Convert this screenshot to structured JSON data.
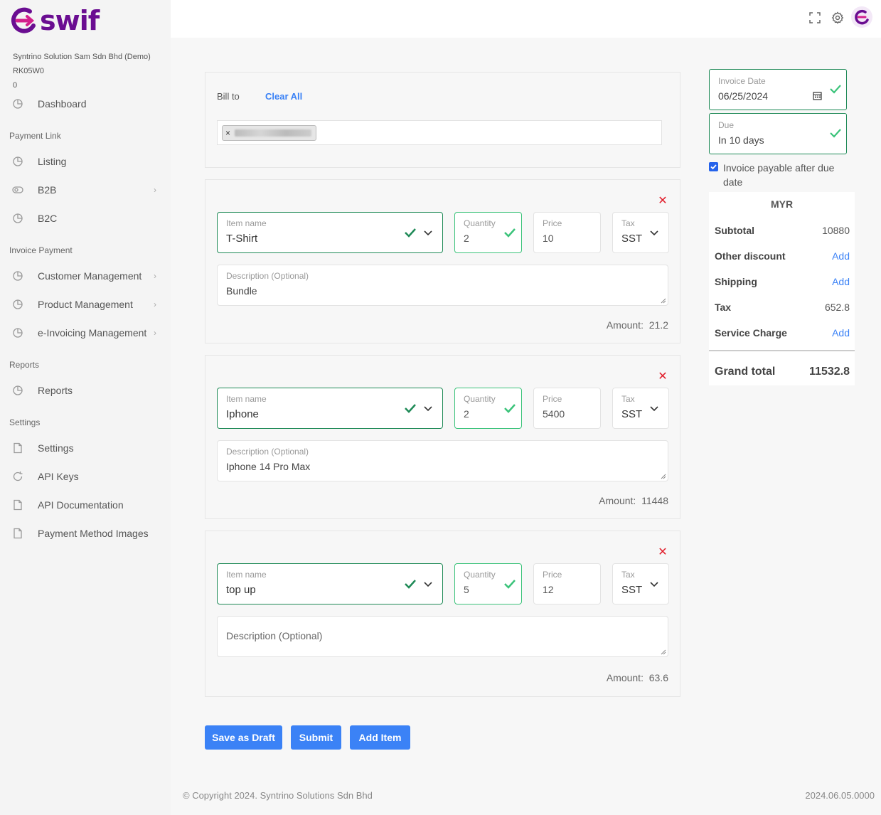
{
  "brand": {
    "name": "swif",
    "color": "#6a0d91",
    "accent": "#d31f8c"
  },
  "company": {
    "name": "Syntrino Solution Sam Sdn Bhd (Demo)",
    "code": "RK05W0",
    "balance": "0"
  },
  "sidebar": {
    "dashboard": "Dashboard",
    "sections": {
      "payment_link": "Payment Link",
      "invoice_payment": "Invoice Payment",
      "reports": "Reports",
      "settings": "Settings"
    },
    "items": {
      "listing": "Listing",
      "b2b": "B2B",
      "b2c": "B2C",
      "customer_management": "Customer Management",
      "product_management": "Product Management",
      "einvoicing_management": "e-Invoicing Management",
      "reports": "Reports",
      "settings": "Settings",
      "api_keys": "API Keys",
      "api_documentation": "API Documentation",
      "payment_method_images": "Payment Method Images"
    }
  },
  "bill_to": {
    "label": "Bill to",
    "clear_all": "Clear All",
    "tag_remove": "×"
  },
  "labels": {
    "item_name": "Item name",
    "quantity": "Quantity",
    "price": "Price",
    "tax": "Tax",
    "description": "Description (Optional)",
    "amount": "Amount:"
  },
  "items": [
    {
      "name": "T-Shirt",
      "quantity": "2",
      "price": "10",
      "tax": "SST",
      "description": "Bundle",
      "amount": "21.2"
    },
    {
      "name": "Iphone",
      "quantity": "2",
      "price": "5400",
      "tax": "SST",
      "description": "Iphone 14 Pro Max",
      "amount": "11448"
    },
    {
      "name": "top up",
      "quantity": "5",
      "price": "12",
      "tax": "SST",
      "description": "",
      "amount": "63.6"
    }
  ],
  "buttons": {
    "save_draft": "Save as Draft",
    "submit": "Submit",
    "add_item": "Add Item"
  },
  "invoice": {
    "date_label": "Invoice Date",
    "date": "06/25/2024",
    "due_label": "Due",
    "due": "In 10 days",
    "payable_after_due": "Invoice payable after due date",
    "payable_checked": true
  },
  "summary": {
    "currency": "MYR",
    "subtotal_label": "Subtotal",
    "subtotal": "10880",
    "other_discount_label": "Other discount",
    "other_discount": "Add",
    "shipping_label": "Shipping",
    "shipping": "Add",
    "tax_label": "Tax",
    "tax": "652.8",
    "service_charge_label": "Service Charge",
    "service_charge": "Add",
    "grand_total_label": "Grand total",
    "grand_total": "11532.8"
  },
  "footer": {
    "copyright": "© Copyright 2024. Syntrino Solutions Sdn Bhd",
    "version": "2024.06.05.0000"
  },
  "colors": {
    "primary": "#3b82f6",
    "valid": "#1f8a57",
    "valid_light": "#3bc37a",
    "danger": "#e11d2a"
  }
}
